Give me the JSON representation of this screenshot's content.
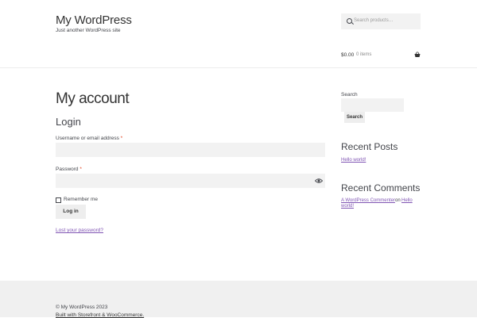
{
  "header": {
    "site_title": "My WordPress",
    "site_description": "Just another WordPress site",
    "search_placeholder": "Search products…",
    "cart_total": "$0.00",
    "cart_items": "0 items"
  },
  "main": {
    "page_title": "My account",
    "login_heading": "Login",
    "username_label": "Username or email address",
    "password_label": "Password",
    "required_marker": "*",
    "remember_label": "Remember me",
    "login_button": "Log in",
    "lost_password": "Lost your password?"
  },
  "sidebar": {
    "search_label": "Search",
    "search_button": "Search",
    "recent_posts_title": "Recent Posts",
    "recent_posts": [
      "Hello world!"
    ],
    "recent_comments_title": "Recent Comments",
    "comment_author": "A WordPress Commenter",
    "comment_on": "on",
    "comment_post_line1": "Hello",
    "comment_post_line2": "world!"
  },
  "footer": {
    "copyright": "© My WordPress 2023",
    "built_with": "Built with Storefront & WooCommerce."
  },
  "colors": {
    "accent": "#7f54b3",
    "required": "#e2401c",
    "footer_bg": "#f0f0f0"
  }
}
